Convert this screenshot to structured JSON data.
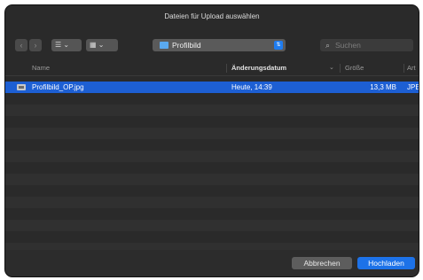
{
  "dialog": {
    "title": "Dateien für Upload auswählen"
  },
  "toolbar": {
    "back_icon": "chevron-left-icon",
    "forward_icon": "chevron-right-icon",
    "list_view_icon": "list-icon",
    "grid_view_icon": "grid-icon",
    "location": "Profilbild",
    "search_placeholder": "Suchen"
  },
  "columns": {
    "name": "Name",
    "date": "Änderungsdatum",
    "size": "Größe",
    "kind": "Art"
  },
  "files": [
    {
      "name": "Profilbild_OP.jpg",
      "date": "Heute, 14:39",
      "size": "13,3 MB",
      "kind": "JPEG"
    }
  ],
  "buttons": {
    "cancel": "Abbrechen",
    "upload": "Hochladen"
  },
  "colors": {
    "selection": "#1d5fd3",
    "primary_button": "#1d72e8",
    "folder": "#5aa9ef"
  }
}
